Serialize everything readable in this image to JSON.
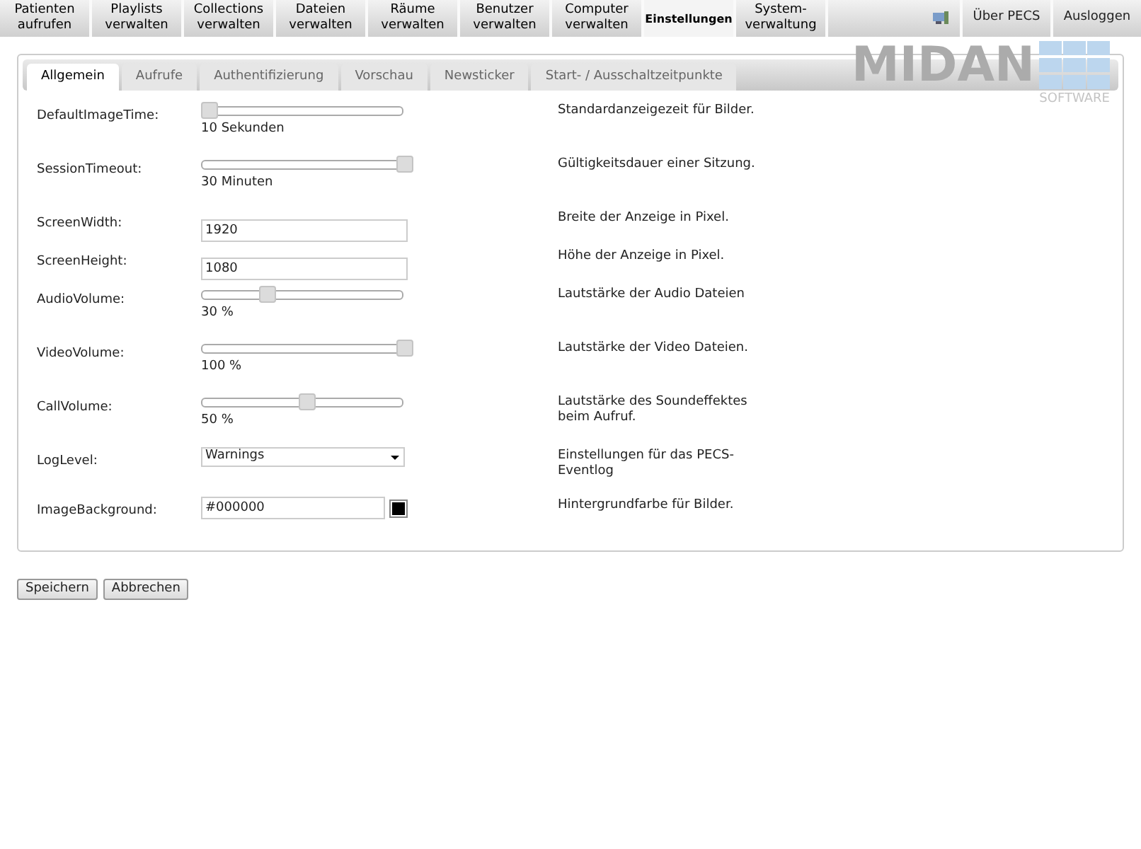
{
  "nav": {
    "items": [
      {
        "label": "Patienten aufrufen",
        "selected": false
      },
      {
        "label": "Playlists verwalten",
        "selected": false
      },
      {
        "label": "Collections verwalten",
        "selected": false
      },
      {
        "label": "Dateien verwalten",
        "selected": false
      },
      {
        "label": "Räume verwalten",
        "selected": false
      },
      {
        "label": "Benutzer verwalten",
        "selected": false
      },
      {
        "label": "Computer verwalten",
        "selected": false
      },
      {
        "label": "Einstellungen",
        "selected": true
      },
      {
        "label": "System-verwaltung",
        "selected": false
      }
    ],
    "right_items": [
      {
        "label": "Über PECS"
      },
      {
        "label": "Ausloggen"
      }
    ]
  },
  "logo": {
    "name": "MIDAN",
    "tagline": "SOFTWARE"
  },
  "tabs": [
    {
      "label": "Allgemein",
      "selected": true
    },
    {
      "label": "Aufrufe",
      "selected": false
    },
    {
      "label": "Authentifizierung",
      "selected": false
    },
    {
      "label": "Vorschau",
      "selected": false
    },
    {
      "label": "Newsticker",
      "selected": false
    },
    {
      "label": "Start- / Ausschaltzeitpunkte",
      "selected": false
    }
  ],
  "settings": [
    {
      "kind": "slider",
      "label": "DefaultImageTime:",
      "level": 0,
      "reading": "10 Sekunden",
      "description": "Standardanzeigezeit für Bilder."
    },
    {
      "kind": "slider",
      "label": "SessionTimeout:",
      "level": 1,
      "reading": "30 Minuten",
      "description": "Gültigkeitsdauer einer Sitzung."
    },
    {
      "kind": "text",
      "label": "ScreenWidth:",
      "value": "1920",
      "description": "Breite der Anzeige in Pixel."
    },
    {
      "kind": "text",
      "label": "ScreenHeight:",
      "value": "1080",
      "description": "Höhe der Anzeige in Pixel."
    },
    {
      "kind": "slider",
      "label": "AudioVolume:",
      "level": 0.3,
      "reading": "30 %",
      "description": "Lautstärke der Audio Dateien"
    },
    {
      "kind": "slider",
      "label": "VideoVolume:",
      "level": 1,
      "reading": "100 %",
      "description": "Lautstärke der Video Dateien."
    },
    {
      "kind": "slider",
      "label": "CallVolume:",
      "level": 0.5,
      "reading": "50 %",
      "description": "Lautstärke des Soundeffektes beim Aufruf."
    },
    {
      "kind": "select",
      "label": "LogLevel:",
      "value": "Warnings",
      "description": "Einstellungen für das PECS-Eventlog"
    },
    {
      "kind": "color",
      "label": "ImageBackground:",
      "value": "#000000",
      "color": "#000000",
      "description": "Hintergrundfarbe für Bilder."
    }
  ],
  "buttons": [
    "Speichern",
    "Abbrechen"
  ]
}
